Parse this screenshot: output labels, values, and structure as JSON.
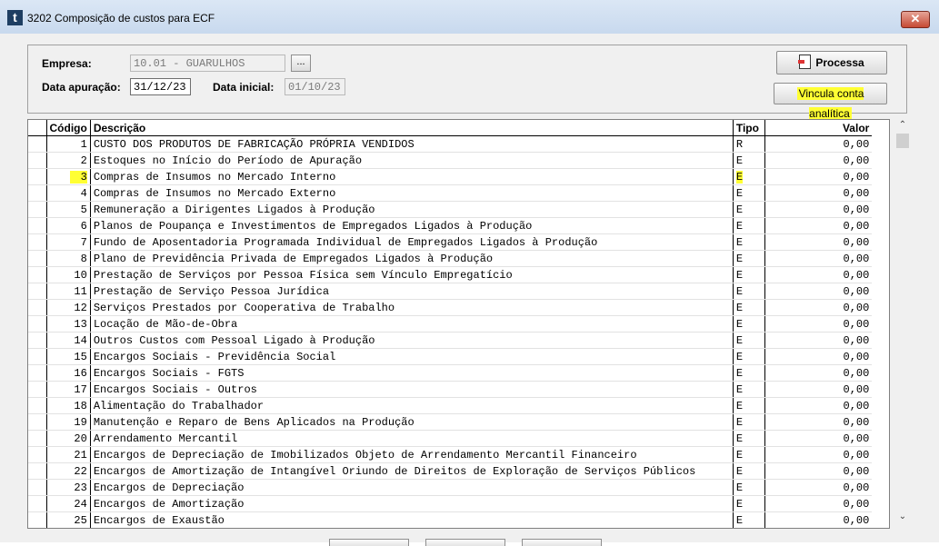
{
  "window": {
    "title": "3202 Composição de custos para ECF",
    "icon_letter": "t",
    "close_glyph": "✕"
  },
  "filters": {
    "empresa_label": "Empresa:",
    "empresa_value": "10.01 - GUARULHOS",
    "lookup_label": "...",
    "data_apuracao_label": "Data apuração:",
    "data_apuracao_value": "31/12/23",
    "data_inicial_label": "Data inicial:",
    "data_inicial_value": "01/10/23"
  },
  "buttons": {
    "processa": "Processa",
    "vincula": "Vincula conta analítica"
  },
  "grid": {
    "headers": {
      "codigo": "Código",
      "descricao": "Descrição",
      "tipo": "Tipo",
      "valor": "Valor"
    },
    "rows": [
      {
        "codigo": "1",
        "descricao": "CUSTO DOS PRODUTOS DE FABRICAÇÃO PRÓPRIA VENDIDOS",
        "tipo": "R",
        "valor": "0,00"
      },
      {
        "codigo": "2",
        "descricao": "Estoques no Início do Período de Apuração",
        "tipo": "E",
        "valor": "0,00"
      },
      {
        "codigo": "3",
        "descricao": "Compras de Insumos no Mercado Interno",
        "tipo": "E",
        "valor": "0,00"
      },
      {
        "codigo": "4",
        "descricao": "Compras de Insumos no Mercado Externo",
        "tipo": "E",
        "valor": "0,00"
      },
      {
        "codigo": "5",
        "descricao": "Remuneração a Dirigentes Ligados à Produção",
        "tipo": "E",
        "valor": "0,00"
      },
      {
        "codigo": "6",
        "descricao": "Planos de Poupança e Investimentos de Empregados Ligados à Produção",
        "tipo": "E",
        "valor": "0,00"
      },
      {
        "codigo": "7",
        "descricao": "Fundo de Aposentadoria Programada Individual de Empregados Ligados à Produção",
        "tipo": "E",
        "valor": "0,00"
      },
      {
        "codigo": "8",
        "descricao": "Plano de Previdência Privada de Empregados Ligados à Produção",
        "tipo": "E",
        "valor": "0,00"
      },
      {
        "codigo": "10",
        "descricao": "Prestação de Serviços por Pessoa Física sem Vínculo Empregatício",
        "tipo": "E",
        "valor": "0,00"
      },
      {
        "codigo": "11",
        "descricao": "Prestação de Serviço Pessoa Jurídica",
        "tipo": "E",
        "valor": "0,00"
      },
      {
        "codigo": "12",
        "descricao": "Serviços Prestados por Cooperativa de Trabalho",
        "tipo": "E",
        "valor": "0,00"
      },
      {
        "codigo": "13",
        "descricao": "Locação de Mão-de-Obra",
        "tipo": "E",
        "valor": "0,00"
      },
      {
        "codigo": "14",
        "descricao": "Outros Custos com Pessoal Ligado à Produção",
        "tipo": "E",
        "valor": "0,00"
      },
      {
        "codigo": "15",
        "descricao": "Encargos Sociais - Previdência Social",
        "tipo": "E",
        "valor": "0,00"
      },
      {
        "codigo": "16",
        "descricao": "Encargos Sociais - FGTS",
        "tipo": "E",
        "valor": "0,00"
      },
      {
        "codigo": "17",
        "descricao": "Encargos Sociais - Outros",
        "tipo": "E",
        "valor": "0,00"
      },
      {
        "codigo": "18",
        "descricao": "Alimentação do Trabalhador",
        "tipo": "E",
        "valor": "0,00"
      },
      {
        "codigo": "19",
        "descricao": "Manutenção e Reparo de Bens Aplicados na Produção",
        "tipo": "E",
        "valor": "0,00"
      },
      {
        "codigo": "20",
        "descricao": "Arrendamento Mercantil",
        "tipo": "E",
        "valor": "0,00"
      },
      {
        "codigo": "21",
        "descricao": "Encargos de Depreciação de Imobilizados Objeto de Arrendamento Mercantil Financeiro",
        "tipo": "E",
        "valor": "0,00"
      },
      {
        "codigo": "22",
        "descricao": "Encargos de Amortização de Intangível Oriundo de Direitos de Exploração de Serviços Públicos",
        "tipo": "E",
        "valor": "0,00"
      },
      {
        "codigo": "23",
        "descricao": "Encargos de Depreciação",
        "tipo": "E",
        "valor": "0,00"
      },
      {
        "codigo": "24",
        "descricao": "Encargos de Amortização",
        "tipo": "E",
        "valor": "0,00"
      },
      {
        "codigo": "25",
        "descricao": "Encargos de Exaustão",
        "tipo": "E",
        "valor": "0,00"
      }
    ]
  },
  "scroll": {
    "up": "⌃",
    "down": "⌄"
  },
  "colors": {
    "highlight": "#ffff33",
    "title_bar": "#c8d9ee",
    "close_button": "#c64a34"
  }
}
